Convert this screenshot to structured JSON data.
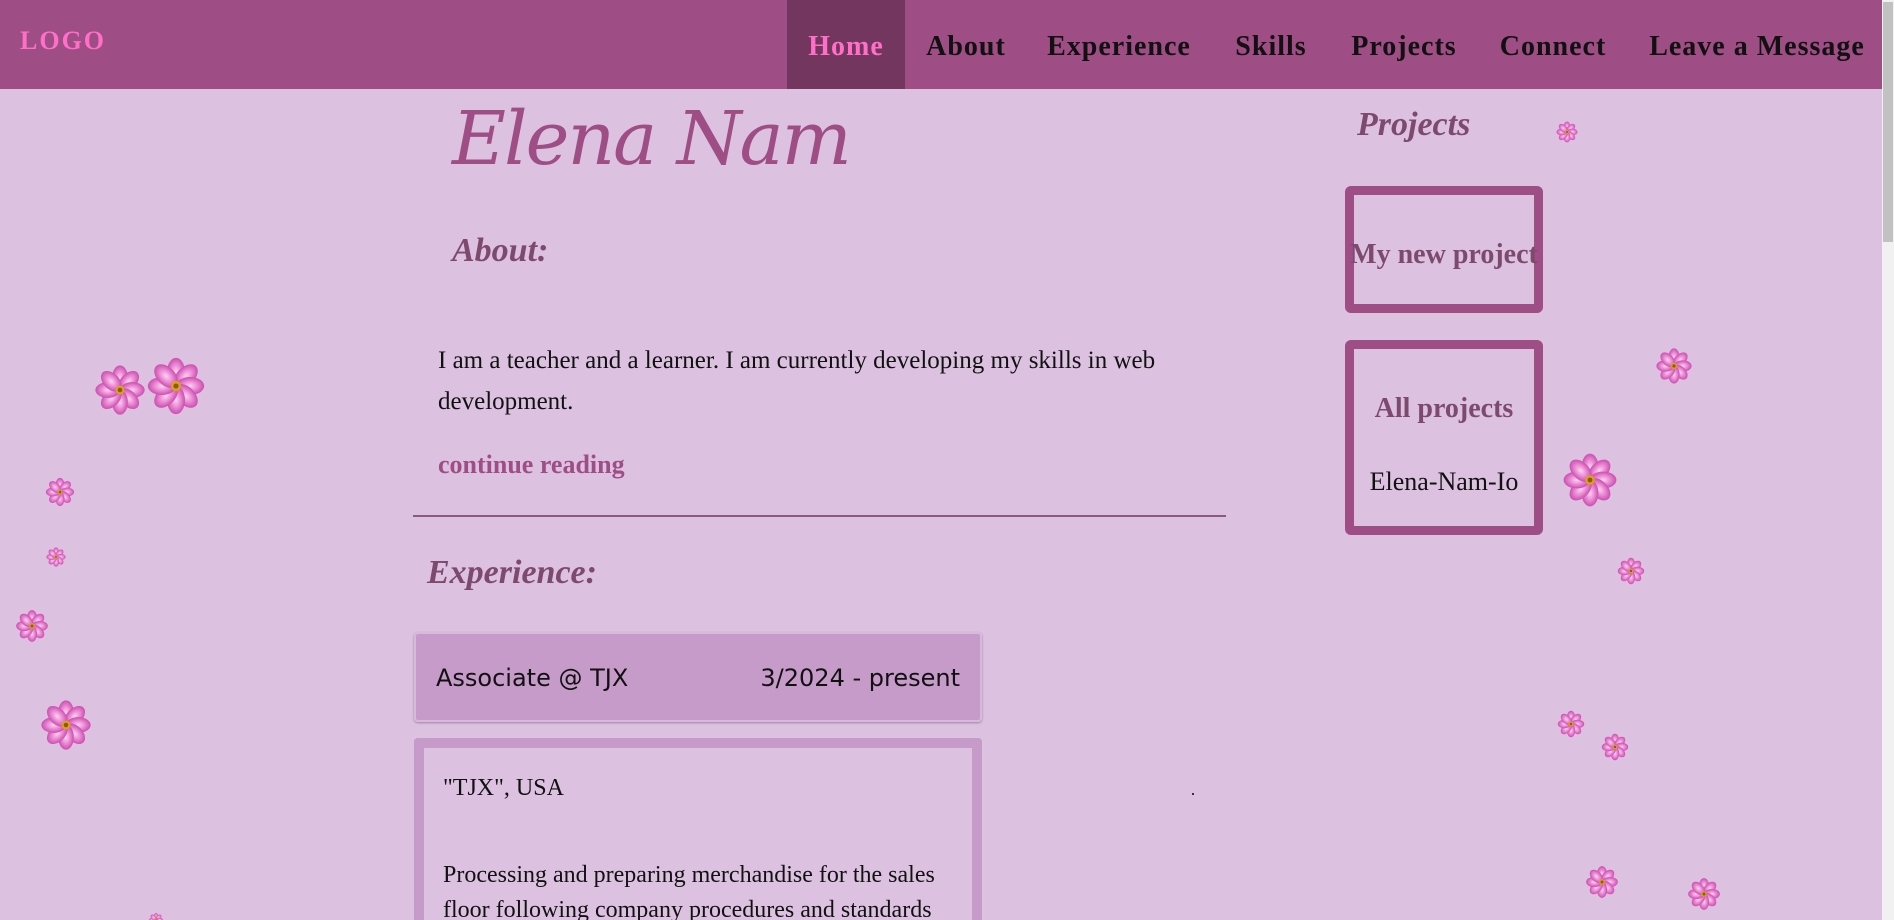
{
  "nav": {
    "logo": "LOGO",
    "items": [
      {
        "label": "Home",
        "active": true
      },
      {
        "label": "About"
      },
      {
        "label": "Experience"
      },
      {
        "label": "Skills"
      },
      {
        "label": "Projects"
      },
      {
        "label": "Connect"
      },
      {
        "label": "Leave a Message"
      }
    ]
  },
  "main": {
    "name": "Elena Nam",
    "about_heading": "About:",
    "about_text": "I am a teacher and a learner. I am currently developing my skills in web development.",
    "continue_link": "continue reading",
    "experience_heading": "Experience:",
    "job": {
      "title": "Associate @ TJX",
      "dates": "3/2024 - present",
      "company": "\"TJX\", USA",
      "description": "Processing and preparing merchandise for the sales floor following company procedures and standards"
    }
  },
  "sidebar": {
    "title": "Projects",
    "projects": [
      {
        "name": "My new project"
      },
      {
        "name": "All projects",
        "sub": "Elena-Nam-Io"
      }
    ]
  },
  "colors": {
    "background": "#dcc2e0",
    "navbar": "#9e4d85",
    "nav_active": "#73365f",
    "accent_pink": "#ff6ec7",
    "job_bar": "#c69bc9",
    "heading": "#7d4a6e"
  },
  "icons": [
    "flower-icon"
  ]
}
